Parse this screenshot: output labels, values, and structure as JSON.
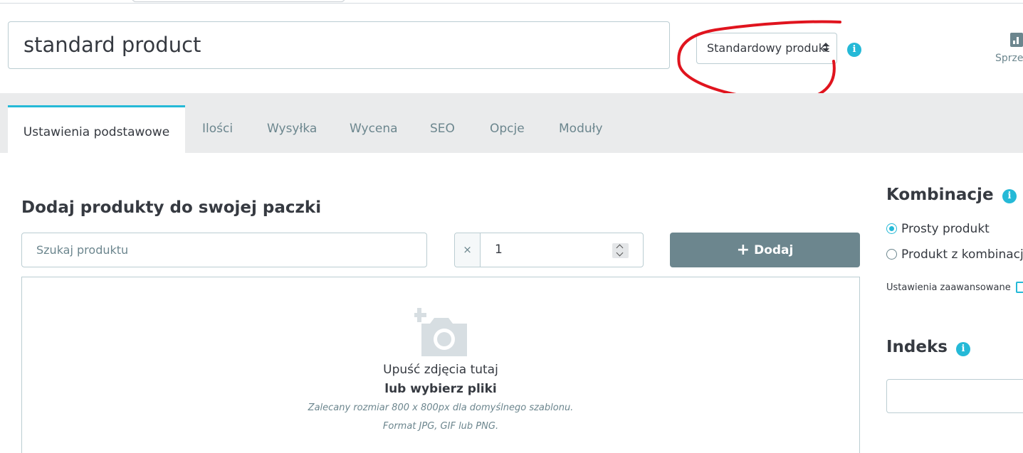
{
  "product": {
    "name": "standard product",
    "type_selected": "Standardowy produkt"
  },
  "header": {
    "stats_label": "Sprzedaż"
  },
  "tabs": [
    {
      "label": "Ustawienia podstawowe"
    },
    {
      "label": "Ilości"
    },
    {
      "label": "Wysyłka"
    },
    {
      "label": "Wycena"
    },
    {
      "label": "SEO"
    },
    {
      "label": "Opcje"
    },
    {
      "label": "Moduły"
    }
  ],
  "pack": {
    "title": "Dodaj produkty do swojej paczki",
    "search_placeholder": "Szukaj produktu",
    "qty_prefix": "×",
    "qty_value": "1",
    "add_label": "Dodaj"
  },
  "dropzone": {
    "main": "Upuść zdjęcia tutaj",
    "sub": "lub wybierz pliki",
    "hint1": "Zalecany rozmiar 800 x 800px dla domyślnego szablonu.",
    "hint2": "Format JPG, GIF lub PNG."
  },
  "sidebar": {
    "combinations_title": "Kombinacje",
    "options": [
      {
        "label": "Prosty produkt",
        "checked": true
      },
      {
        "label": "Produkt z kombinacjami",
        "checked": false
      }
    ],
    "advanced_label": "Ustawienia zaawansowane",
    "index_title": "Indeks"
  },
  "icons": {
    "info": "info-icon",
    "stats": "bar-chart-icon",
    "camera": "add-photo-icon",
    "external": "external-link-icon"
  },
  "colors": {
    "accent": "#25b9d7",
    "button": "#6c868e",
    "annotation": "#e0141e"
  }
}
